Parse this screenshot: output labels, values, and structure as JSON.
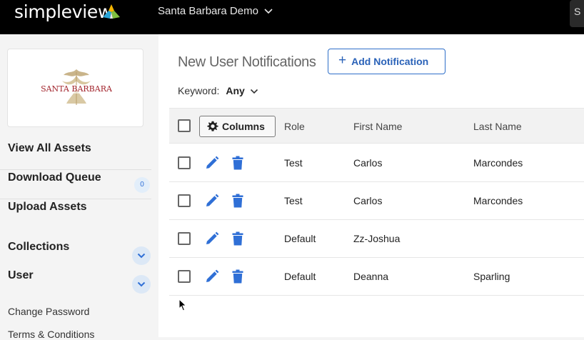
{
  "topbar": {
    "brand": "simpleview",
    "site_name": "Santa Barbara Demo",
    "right_button_label": "S"
  },
  "sidebar": {
    "logo_alt": "Santa Barbara The American Riviera",
    "items": [
      {
        "label": "View All Assets"
      },
      {
        "label": "Download Queue",
        "badge": "0"
      },
      {
        "label": "Upload Assets"
      },
      {
        "label": "Collections"
      },
      {
        "label": "User"
      }
    ],
    "sub_items": [
      {
        "label": "Change Password"
      },
      {
        "label": "Terms & Conditions"
      }
    ]
  },
  "main": {
    "title": "New User Notifications",
    "add_button": "Add Notification",
    "keyword_label": "Keyword:",
    "keyword_value": "Any",
    "table": {
      "columns_button": "Columns",
      "headers": [
        "Role",
        "First Name",
        "Last Name"
      ],
      "rows": [
        {
          "role": "Test",
          "first": "Carlos",
          "last": "Marcondes"
        },
        {
          "role": "Test",
          "first": "Carlos",
          "last": "Marcondes"
        },
        {
          "role": "Default",
          "first": "Zz-Joshua",
          "last": ""
        },
        {
          "role": "Default",
          "first": "Deanna",
          "last": "Sparling"
        }
      ]
    }
  },
  "colors": {
    "accent": "#2e6fc9",
    "topbar": "#000000",
    "icon_blue": "#2f6fd6"
  }
}
